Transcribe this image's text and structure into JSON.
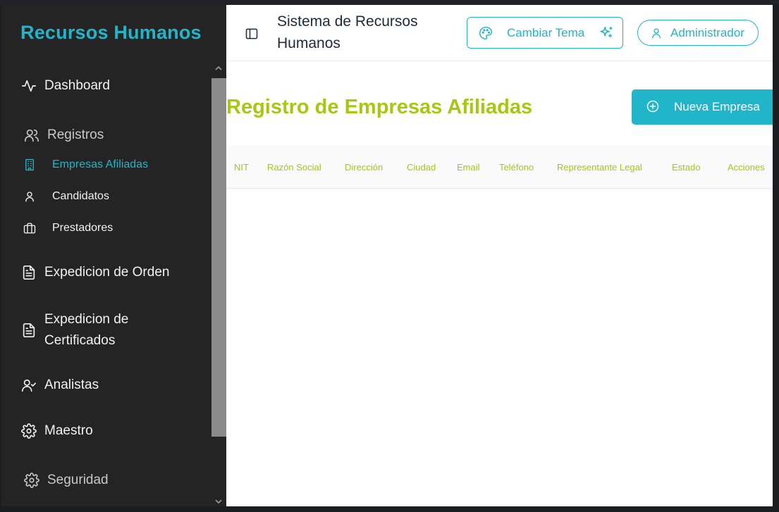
{
  "sidebar": {
    "brand": "Recursos Humanos",
    "items": {
      "dashboard": "Dashboard",
      "registros": "Registros",
      "empresas": "Empresas Afiliadas",
      "candidatos": "Candidatos",
      "prestadores": "Prestadores",
      "expedicion_orden": "Expedicion de Orden",
      "expedicion_cert_1": "Expedicion de",
      "expedicion_cert_2": "Certificados",
      "analistas": "Analistas",
      "maestro": "Maestro",
      "seguridad": "Seguridad"
    },
    "active_item": "Empresas Afiliadas"
  },
  "header": {
    "title": "Sistema de Recursos Humanos",
    "theme_button": "Cambiar Tema",
    "user_button": "Administrador"
  },
  "main": {
    "page_title": "Registro de Empresas Afiliadas",
    "new_button": "Nueva Empresa",
    "table": {
      "columns": [
        "NIT",
        "Razón Social",
        "Dirección",
        "Ciudad",
        "Email",
        "Teléfono",
        "Representante Legal",
        "Estado",
        "Acciones"
      ],
      "rows": []
    }
  },
  "colors": {
    "accent": "#21b5c9",
    "title_green": "#a6c812",
    "sidebar_bg": "#242424"
  },
  "icons": {
    "dashboard": "activity-icon",
    "registros": "users-icon",
    "empresas": "building-icon",
    "candidatos": "user-icon",
    "prestadores": "briefcase-icon",
    "orden": "file-text-icon",
    "certificados": "file-text-icon",
    "analistas": "user-check-icon",
    "maestro": "gear-icon",
    "seguridad": "gear-icon",
    "panel": "panel-left-icon",
    "theme": "palette-icon",
    "sparkle": "sparkles-icon",
    "admin": "user-icon",
    "new": "plus-circle-icon"
  }
}
